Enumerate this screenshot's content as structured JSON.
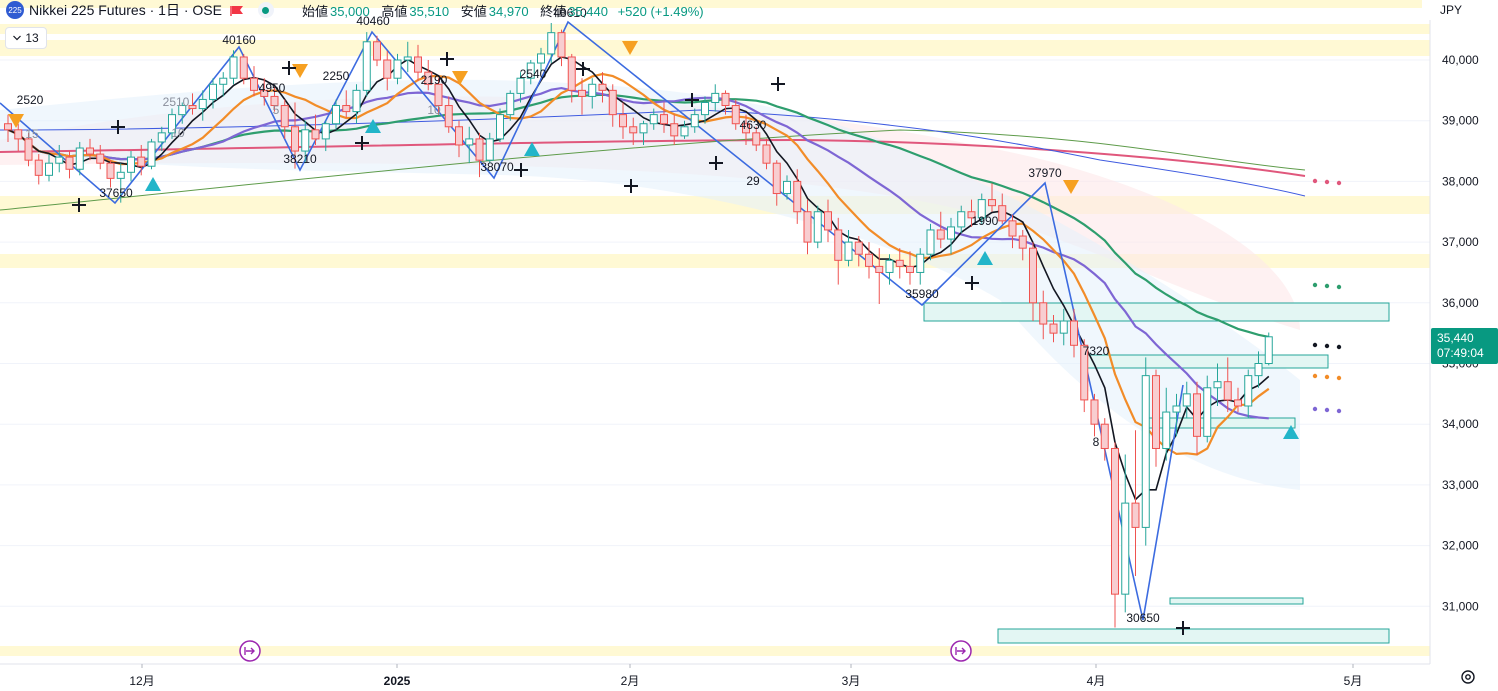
{
  "header": {
    "symbol_badge": "225",
    "title": "Nikkei 225 Futures · 1日 · OSE",
    "open_label": "始値",
    "open": "35,000",
    "high_label": "高値",
    "high": "35,510",
    "low_label": "安値",
    "low": "34,970",
    "close_label": "終値",
    "close": "35,440",
    "change": "+520 (+1.49%)",
    "indicator_toggle": "13",
    "currency": "JPY"
  },
  "last_price": {
    "price": "35,440",
    "countdown": "07:49:04"
  },
  "colors": {
    "up": "#26a69a",
    "down": "#ef5350",
    "zigzag": "#3c6be0",
    "ma_black": "#131722",
    "ma_orange": "#f28c28",
    "ma_purple": "#7e66d4",
    "ma_green": "#2e9e6e",
    "ma_pink": "#e0577c",
    "ma_thin_blue": "#3f5be0",
    "ma_thin_green": "#5e9b4a",
    "signal_down": "#f6a021",
    "signal_up": "#22b5c9"
  },
  "chart_data": {
    "type": "candlestick",
    "y_axis": {
      "min": 30200,
      "max": 40800,
      "ticks": [
        "31,000",
        "32,000",
        "33,000",
        "34,000",
        "35,000",
        "36,000",
        "37,000",
        "38,000",
        "39,000",
        "40,000"
      ]
    },
    "x_axis": {
      "labels": [
        "12月",
        "2025",
        "2月",
        "3月",
        "4月",
        "5月"
      ]
    },
    "candles": [
      [
        38950,
        39100,
        38650,
        38850
      ],
      [
        38850,
        38950,
        38500,
        38700
      ],
      [
        38700,
        38800,
        38250,
        38350
      ],
      [
        38350,
        38450,
        37950,
        38100
      ],
      [
        38100,
        38450,
        38000,
        38300
      ],
      [
        38300,
        38600,
        38150,
        38400
      ],
      [
        38400,
        38500,
        38050,
        38200
      ],
      [
        38200,
        38650,
        38100,
        38550
      ],
      [
        38550,
        38700,
        38350,
        38450
      ],
      [
        38450,
        38600,
        38200,
        38300
      ],
      [
        38300,
        38350,
        37900,
        38050
      ],
      [
        38050,
        38300,
        37650,
        38150
      ],
      [
        38150,
        38500,
        38000,
        38400
      ],
      [
        38400,
        38600,
        38100,
        38250
      ],
      [
        38250,
        38700,
        38200,
        38650
      ],
      [
        38650,
        38900,
        38500,
        38800
      ],
      [
        38800,
        39200,
        38700,
        39100
      ],
      [
        39100,
        39300,
        38950,
        39250
      ],
      [
        39250,
        39450,
        39100,
        39200
      ],
      [
        39200,
        39500,
        39000,
        39350
      ],
      [
        39350,
        39700,
        39200,
        39600
      ],
      [
        39600,
        39800,
        39400,
        39700
      ],
      [
        39700,
        40160,
        39600,
        40050
      ],
      [
        40050,
        40100,
        39600,
        39700
      ],
      [
        39700,
        39900,
        39400,
        39500
      ],
      [
        39500,
        39700,
        39250,
        39400
      ],
      [
        39400,
        39550,
        39150,
        39250
      ],
      [
        39250,
        39350,
        38700,
        38900
      ],
      [
        38900,
        39300,
        38210,
        38500
      ],
      [
        38500,
        39000,
        38300,
        38850
      ],
      [
        38850,
        39100,
        38600,
        38700
      ],
      [
        38700,
        39000,
        38500,
        38950
      ],
      [
        38950,
        39350,
        38850,
        39250
      ],
      [
        39250,
        39500,
        39050,
        39150
      ],
      [
        39150,
        39600,
        38950,
        39500
      ],
      [
        39500,
        40460,
        39400,
        40300
      ],
      [
        40300,
        40400,
        39900,
        40000
      ],
      [
        40000,
        40150,
        39500,
        39700
      ],
      [
        39700,
        40100,
        39600,
        40000
      ],
      [
        40000,
        40300,
        39800,
        40050
      ],
      [
        40050,
        40250,
        39650,
        39800
      ],
      [
        39800,
        40000,
        39500,
        39600
      ],
      [
        39600,
        39700,
        39100,
        39250
      ],
      [
        39250,
        39400,
        38800,
        38900
      ],
      [
        38900,
        39000,
        38400,
        38600
      ],
      [
        38600,
        38900,
        38300,
        38700
      ],
      [
        38700,
        38800,
        38070,
        38350
      ],
      [
        38350,
        38800,
        38300,
        38700
      ],
      [
        38700,
        39200,
        38650,
        39100
      ],
      [
        39100,
        39500,
        39000,
        39450
      ],
      [
        39450,
        39800,
        39300,
        39700
      ],
      [
        39700,
        40000,
        39600,
        39950
      ],
      [
        39950,
        40200,
        39800,
        40100
      ],
      [
        40100,
        40610,
        39950,
        40450
      ],
      [
        40450,
        40500,
        39900,
        40050
      ],
      [
        40050,
        40100,
        39300,
        39500
      ],
      [
        39500,
        39700,
        39100,
        39400
      ],
      [
        39400,
        39700,
        39200,
        39600
      ],
      [
        39600,
        39800,
        39300,
        39500
      ],
      [
        39500,
        39600,
        38900,
        39100
      ],
      [
        39100,
        39300,
        38700,
        38900
      ],
      [
        38900,
        39050,
        38600,
        38800
      ],
      [
        38800,
        39000,
        38600,
        38950
      ],
      [
        38950,
        39200,
        38850,
        39100
      ],
      [
        39100,
        39300,
        38800,
        38950
      ],
      [
        38950,
        39100,
        38600,
        38750
      ],
      [
        38750,
        39000,
        38700,
        38900
      ],
      [
        38900,
        39200,
        38800,
        39100
      ],
      [
        39100,
        39400,
        38950,
        39300
      ],
      [
        39300,
        39600,
        39150,
        39450
      ],
      [
        39450,
        39500,
        39100,
        39250
      ],
      [
        39250,
        39350,
        38850,
        38950
      ],
      [
        38950,
        39100,
        38600,
        38800
      ],
      [
        38800,
        38900,
        38500,
        38600
      ],
      [
        38600,
        38700,
        38200,
        38300
      ],
      [
        38300,
        38350,
        37600,
        37800
      ],
      [
        37800,
        38100,
        37700,
        38000
      ],
      [
        38000,
        38200,
        37300,
        37500
      ],
      [
        37500,
        37700,
        36800,
        37000
      ],
      [
        37000,
        37600,
        36900,
        37500
      ],
      [
        37500,
        37700,
        37000,
        37200
      ],
      [
        37200,
        37400,
        36300,
        36700
      ],
      [
        36700,
        37200,
        36600,
        37000
      ],
      [
        37000,
        37100,
        36600,
        36800
      ],
      [
        36800,
        37000,
        36400,
        36600
      ],
      [
        36600,
        36900,
        35980,
        36500
      ],
      [
        36500,
        36800,
        36300,
        36700
      ],
      [
        36700,
        36900,
        36400,
        36600
      ],
      [
        36600,
        36850,
        36300,
        36500
      ],
      [
        36500,
        36900,
        36300,
        36800
      ],
      [
        36800,
        37300,
        36700,
        37200
      ],
      [
        37200,
        37500,
        36900,
        37050
      ],
      [
        37050,
        37400,
        36800,
        37250
      ],
      [
        37250,
        37600,
        37150,
        37500
      ],
      [
        37500,
        37700,
        37250,
        37400
      ],
      [
        37400,
        37800,
        37300,
        37700
      ],
      [
        37700,
        37970,
        37500,
        37600
      ],
      [
        37600,
        37800,
        37300,
        37350
      ],
      [
        37350,
        37450,
        36900,
        37100
      ],
      [
        37100,
        37200,
        36700,
        36900
      ],
      [
        36900,
        37000,
        35700,
        36000
      ],
      [
        36000,
        36200,
        35400,
        35650
      ],
      [
        35650,
        35800,
        35350,
        35500
      ],
      [
        35500,
        35900,
        35300,
        35700
      ],
      [
        35700,
        35900,
        35100,
        35300
      ],
      [
        35300,
        35400,
        34200,
        34400
      ],
      [
        34400,
        34500,
        33800,
        34000
      ],
      [
        34000,
        34100,
        33400,
        33600
      ],
      [
        33600,
        33700,
        30650,
        31200
      ],
      [
        31200,
        33500,
        30900,
        32700
      ],
      [
        32700,
        33900,
        31500,
        32300
      ],
      [
        32300,
        35100,
        32000,
        34800
      ],
      [
        34800,
        34900,
        33300,
        33600
      ],
      [
        33600,
        34600,
        33400,
        34200
      ],
      [
        34200,
        34500,
        33800,
        34300
      ],
      [
        34300,
        34700,
        34100,
        34500
      ],
      [
        34500,
        34700,
        33500,
        33800
      ],
      [
        33800,
        34800,
        33700,
        34600
      ],
      [
        34600,
        35000,
        34300,
        34700
      ],
      [
        34700,
        35100,
        34200,
        34400
      ],
      [
        34400,
        34600,
        34200,
        34300
      ],
      [
        34300,
        34900,
        34100,
        34800
      ],
      [
        34800,
        35200,
        34600,
        35000
      ],
      [
        35000,
        35510,
        34970,
        35440
      ]
    ]
  },
  "annotations": {
    "peak_labels": [
      "2520",
      "37650",
      "40160",
      "4950",
      "38210",
      "2250",
      "40460",
      "2190",
      "38070",
      "2540",
      "40610",
      "4630",
      "29",
      "35980",
      "1990",
      "37970",
      "7320",
      "8",
      "30650"
    ],
    "minor_labels": [
      "15",
      "2510",
      "10",
      "5",
      "10"
    ],
    "price_box_labels": [
      "7320"
    ]
  }
}
